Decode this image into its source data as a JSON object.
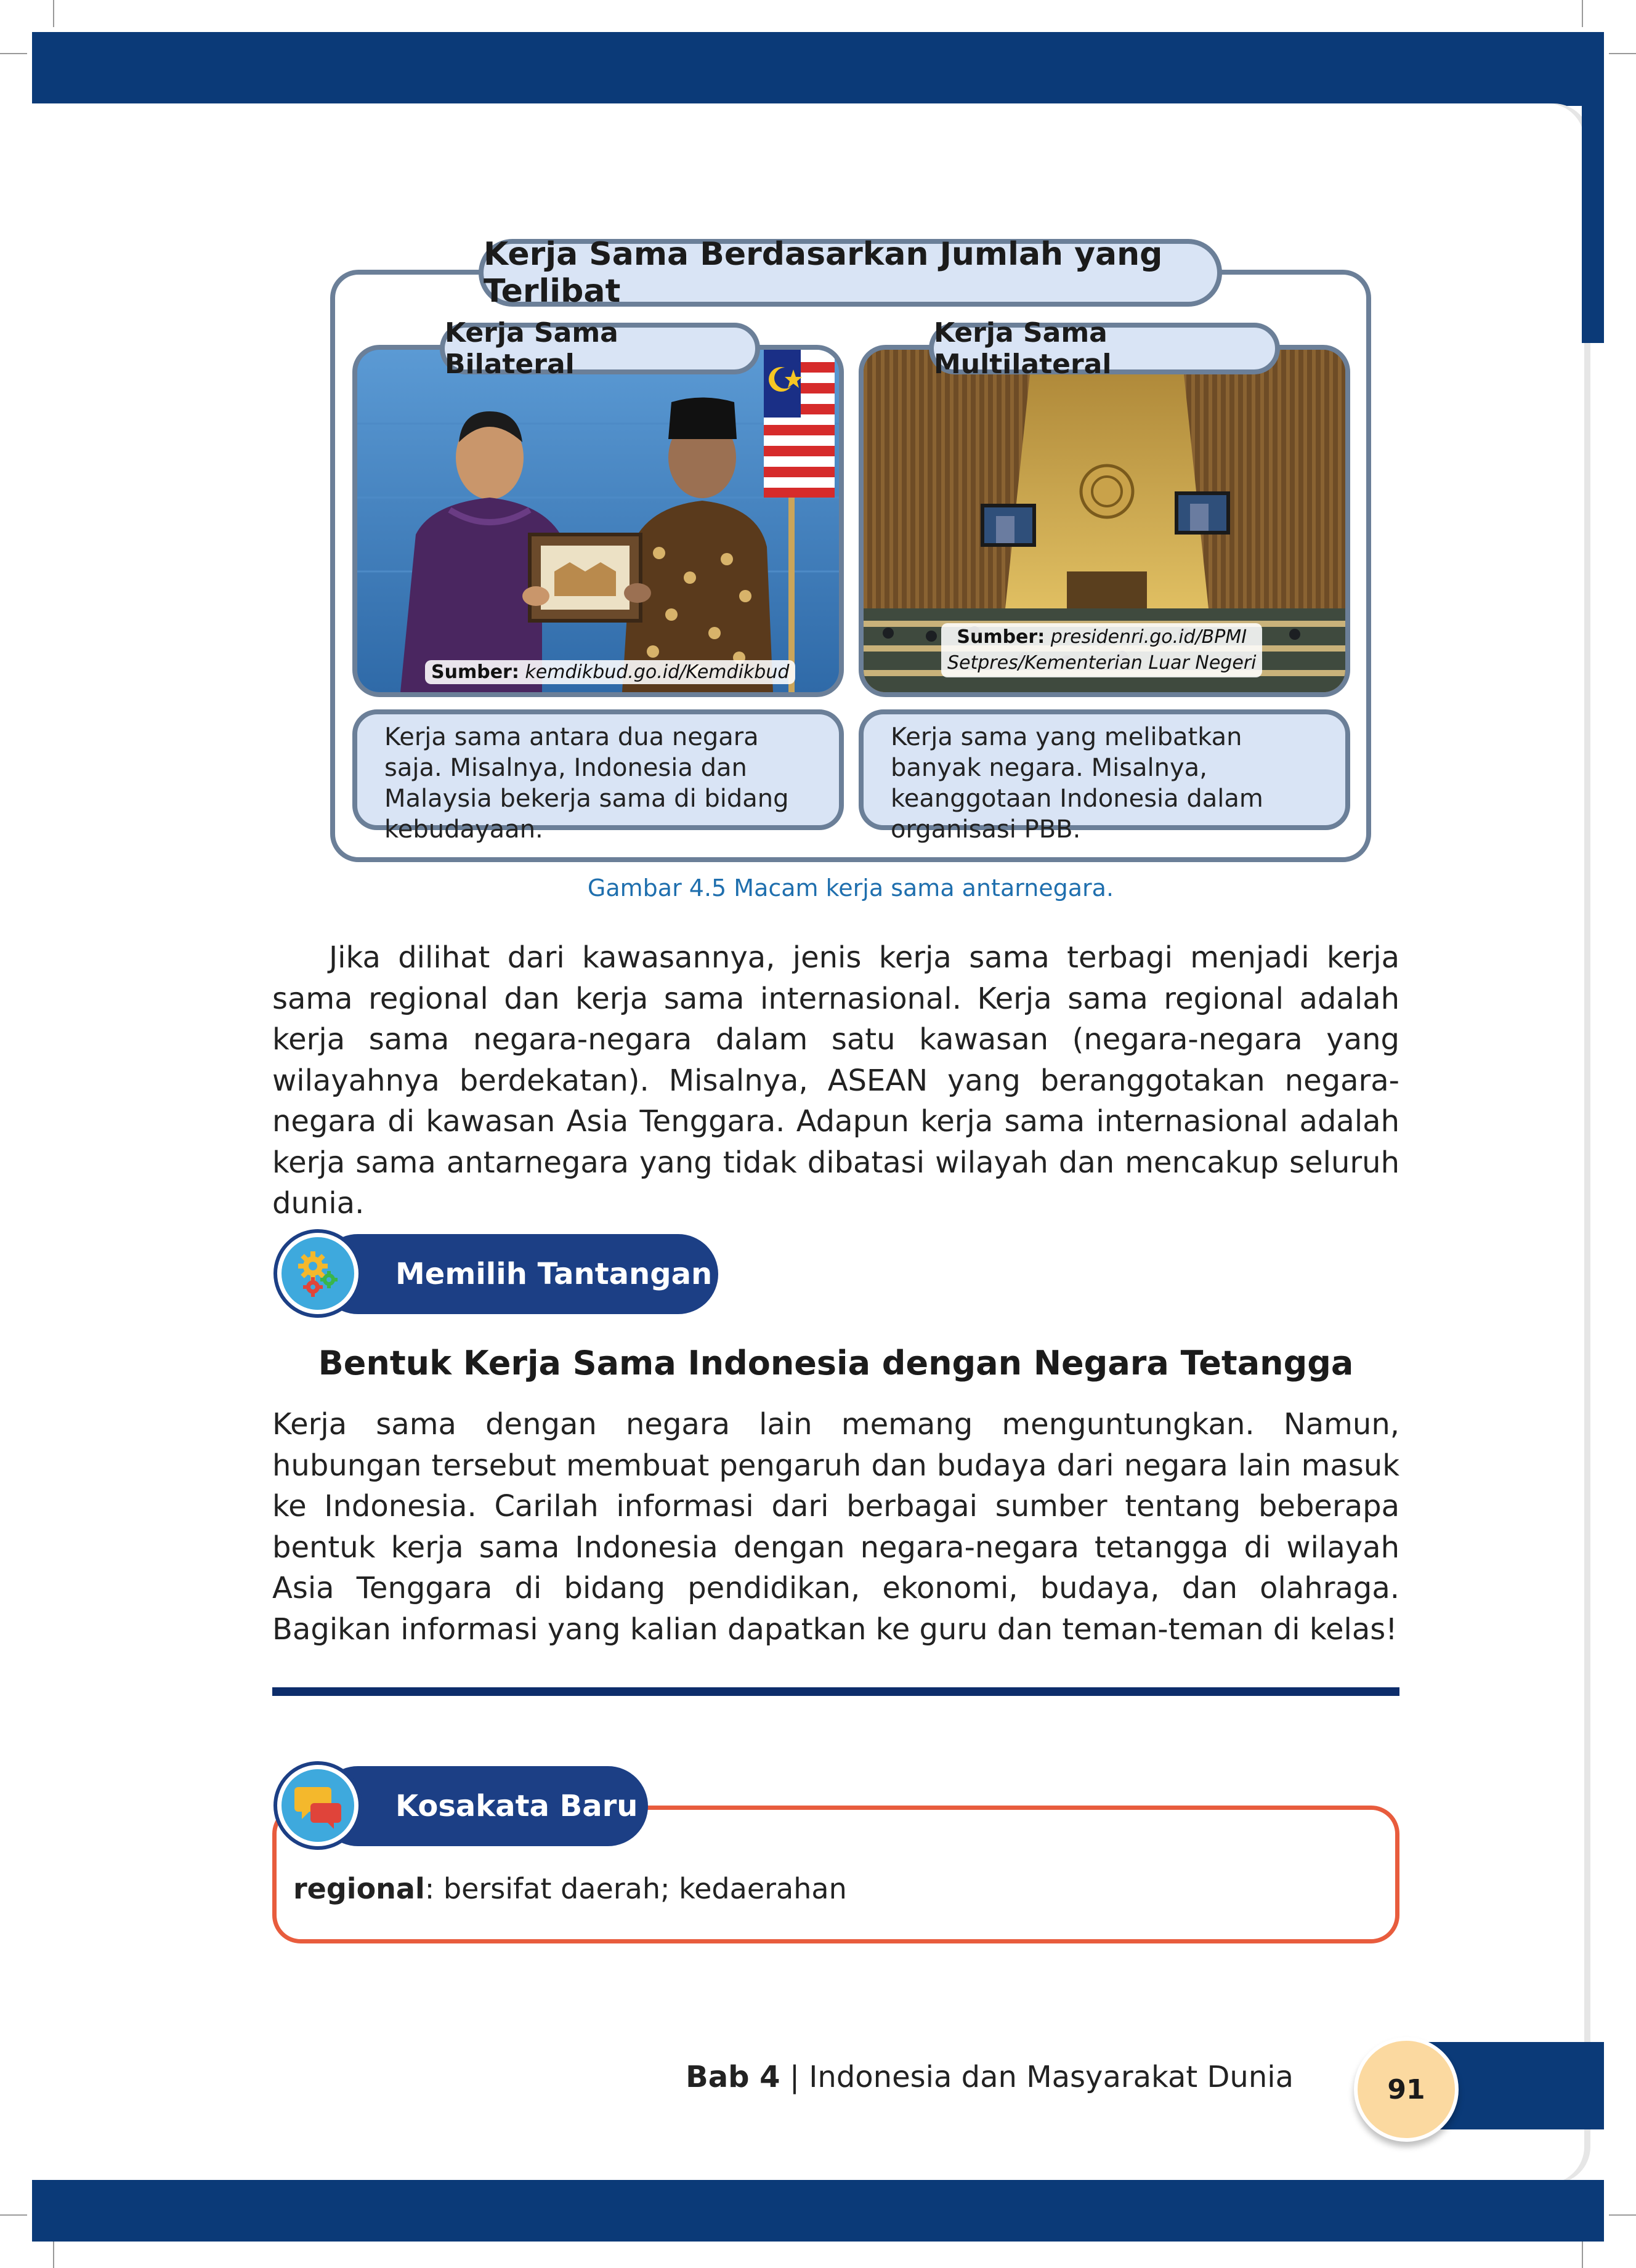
{
  "figure": {
    "title": "Kerja Sama Berdasarkan Jumlah yang Terlibat",
    "bilateral": {
      "label": "Kerja Sama Bilateral",
      "source_prefix": "Sumber:",
      "source_text": "kemdikbud.go.id/Kemdikbud",
      "description": "Kerja sama antara dua negara saja. Misalnya, Indonesia dan Malaysia bekerja sama di bidang kebudayaan."
    },
    "multilateral": {
      "label": "Kerja Sama Multilateral",
      "source_prefix": "Sumber:",
      "source_line1": "presidenri.go.id/BPMI",
      "source_line2": "Setpres/Kementerian Luar Negeri",
      "description": "Kerja sama yang melibatkan banyak negara. Misalnya, keanggotaan Indonesia dalam organisasi PBB."
    },
    "caption": "Gambar 4.5 Macam kerja sama antarnegara."
  },
  "paragraph1": "Jika dilihat dari kawasannya, jenis kerja sama terbagi menjadi  kerja sama regional dan kerja sama internasional. Kerja sama regional adalah kerja sama negara-negara dalam satu kawasan (negara-negara yang wilayahnya berdekatan). Misalnya, ASEAN yang beranggotakan negara-negara di kawasan Asia Tenggara. Adapun kerja sama internasional adalah kerja sama antarnegara yang tidak dibatasi wilayah dan mencakup seluruh dunia.",
  "challenge": {
    "label": "Memilih Tantangan",
    "icon": "gears-icon",
    "title": "Bentuk Kerja Sama Indonesia dengan Negara Tetangga",
    "body": "Kerja sama dengan negara lain memang menguntungkan. Namun, hubungan tersebut membuat pengaruh dan budaya dari negara lain masuk ke Indonesia. Carilah informasi dari berbagai sumber tentang beberapa bentuk kerja sama Indonesia dengan negara-negara tetangga di wilayah Asia Tenggara di bidang pendidikan, ekonomi, budaya, dan olahraga. Bagikan informasi yang kalian dapatkan ke guru dan teman-teman di kelas!"
  },
  "vocab": {
    "label": "Kosakata Baru",
    "icon": "chat-bubbles-icon",
    "term": "regional",
    "definition": ": bersifat daerah; kedaerahan"
  },
  "footer": {
    "chapter": "Bab 4",
    "separator": " | ",
    "title": "Indonesia dan Masyarakat Dunia",
    "page_number": "91"
  },
  "colors": {
    "brand_navy": "#0b3a78",
    "pill_fill": "#d9e4f5",
    "frame_gray": "#6b7f98",
    "caption_blue": "#1f6fae",
    "vocab_border": "#e85c3d",
    "page_badge": "#fbd9a0"
  }
}
